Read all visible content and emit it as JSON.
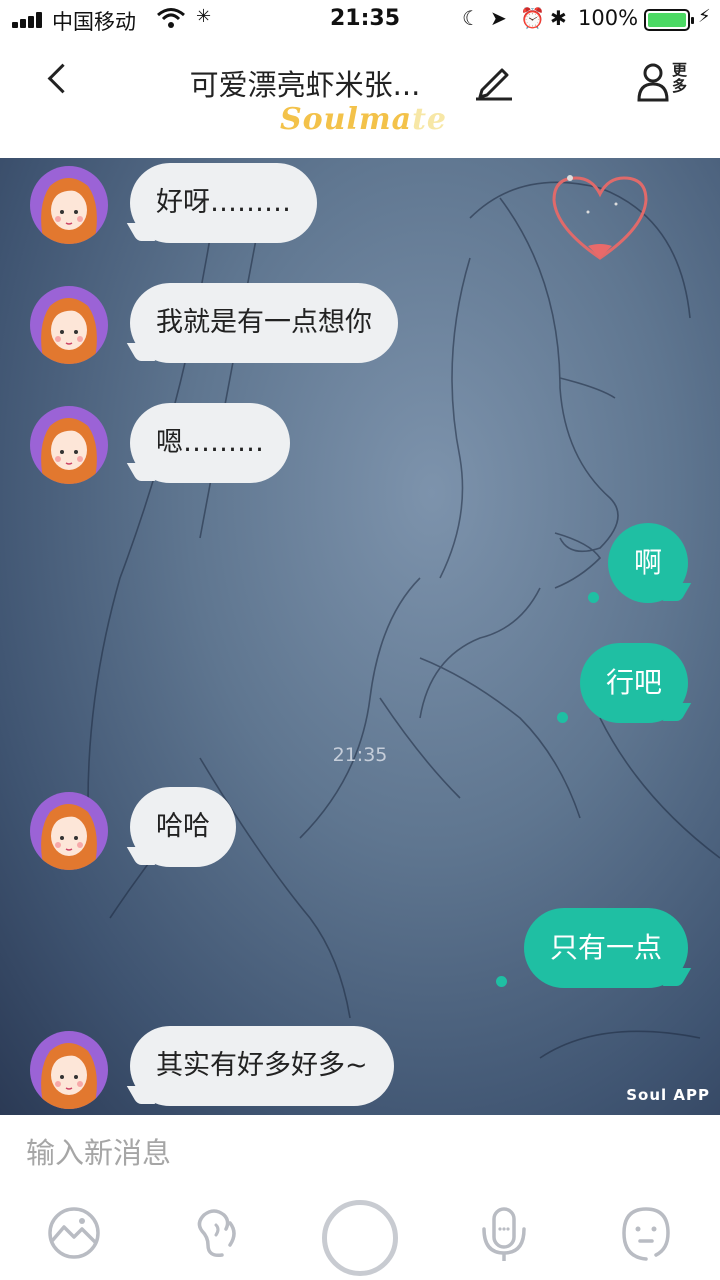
{
  "status_bar": {
    "carrier": "中国移动",
    "time": "21:35",
    "battery": "100%"
  },
  "nav": {
    "title": "可爱漂亮虾米张...",
    "logo_main": "Soulma",
    "logo_faded": "te",
    "more_label": "更多"
  },
  "chat": {
    "timestamp": "21:35",
    "watermark": "Soul APP",
    "messages": [
      {
        "side": "in",
        "text": "好呀………"
      },
      {
        "side": "in",
        "text": "我就是有一点想你"
      },
      {
        "side": "in",
        "text": "嗯………"
      },
      {
        "side": "out",
        "text": "啊"
      },
      {
        "side": "out",
        "text": "行吧"
      },
      {
        "side": "in",
        "text": "哈哈"
      },
      {
        "side": "out",
        "text": "只有一点"
      },
      {
        "side": "in",
        "text": "其实有好多好多~"
      }
    ]
  },
  "input": {
    "placeholder": "输入新消息"
  },
  "toolbar": {
    "icons": [
      "image-icon",
      "voice-icon",
      "record-icon",
      "mic-icon",
      "emoji-icon"
    ]
  },
  "colors": {
    "accent": "#1fbfa3",
    "incoming_bubble": "#eef0f2",
    "avatar_bg": "#9b63d6",
    "logo": "#f3c24a"
  }
}
